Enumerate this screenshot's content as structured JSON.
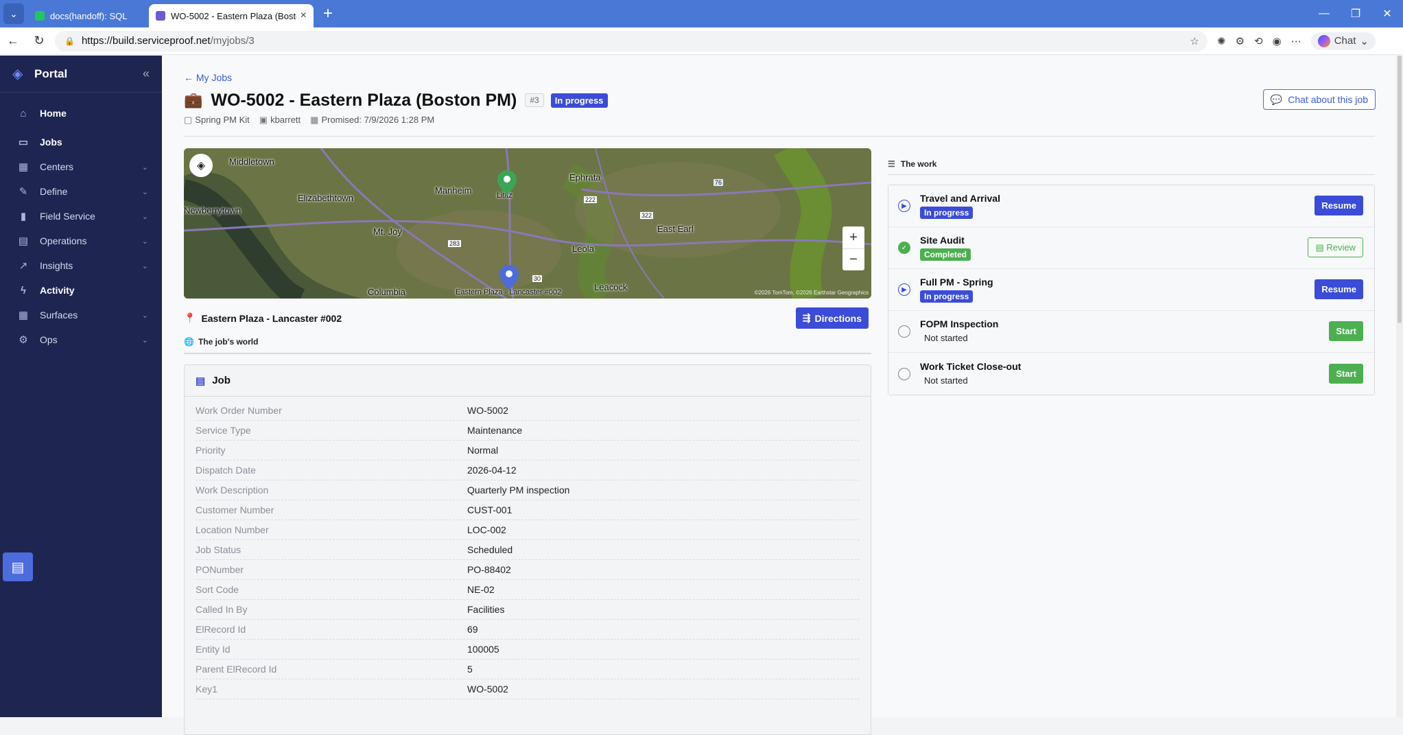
{
  "browser": {
    "tabs": [
      {
        "title": "docs(handoff): SQL",
        "active": false
      },
      {
        "title": "WO-5002 - Eastern Plaza (Boston PM)",
        "active": true
      }
    ],
    "url_host": "https://build.serviceproof.net",
    "url_path": "/myjobs/3",
    "chat_label": "Chat"
  },
  "sidebar": {
    "brand": "Portal",
    "items": [
      {
        "label": "Home",
        "icon": "home-icon",
        "chevron": false
      },
      {
        "label": "Jobs",
        "icon": "inbox-icon",
        "chevron": false
      },
      {
        "label": "Centers",
        "icon": "grid-icon",
        "chevron": true
      },
      {
        "label": "Define",
        "icon": "edit-icon",
        "chevron": true
      },
      {
        "label": "Field Service",
        "icon": "chart-bars-icon",
        "chevron": true
      },
      {
        "label": "Operations",
        "icon": "briefcase-icon",
        "chevron": true
      },
      {
        "label": "Insights",
        "icon": "trend-icon",
        "chevron": true
      },
      {
        "label": "Activity",
        "icon": "bolt-icon",
        "chevron": false
      },
      {
        "label": "Surfaces",
        "icon": "apps-icon",
        "chevron": true
      },
      {
        "label": "Ops",
        "icon": "gear-icon",
        "chevron": true
      }
    ]
  },
  "page": {
    "back_label": "My Jobs",
    "title": "WO-5002 - Eastern Plaza (Boston PM)",
    "number_badge": "#3",
    "status": "In progress",
    "chat_job_label": "Chat about this job",
    "meta": {
      "kit": "Spring PM Kit",
      "user": "kbarrett",
      "promised": "Promised: 7/9/2026 1:28 PM"
    }
  },
  "map": {
    "labels": [
      "Middletown",
      "Elizabethtown",
      "Newberrytown",
      "Manheim",
      "Lititz",
      "Ephrata",
      "Mt. Joy",
      "Leola",
      "East Earl",
      "Columbia",
      "Leacock",
      "Eastern Plaza - Lancaster #002"
    ],
    "route_shields": [
      "222",
      "322",
      "283",
      "30",
      "76"
    ],
    "copyright": "©2026 TomTom, ©2026 Earthstar Geographics",
    "zoom_in": "+",
    "zoom_out": "−"
  },
  "location": {
    "name": "Eastern Plaza - Lancaster #002",
    "directions_label": "Directions"
  },
  "world_title": "The job's world",
  "job": {
    "header": "Job",
    "fields": [
      {
        "k": "Work Order Number",
        "v": "WO-5002"
      },
      {
        "k": "Service Type",
        "v": "Maintenance"
      },
      {
        "k": "Priority",
        "v": "Normal"
      },
      {
        "k": "Dispatch Date",
        "v": "2026-04-12"
      },
      {
        "k": "Work Description",
        "v": "Quarterly PM inspection"
      },
      {
        "k": "Customer Number",
        "v": "CUST-001"
      },
      {
        "k": "Location Number",
        "v": "LOC-002"
      },
      {
        "k": "Job Status",
        "v": "Scheduled"
      },
      {
        "k": "PONumber",
        "v": "PO-88402"
      },
      {
        "k": "Sort Code",
        "v": "NE-02"
      },
      {
        "k": "Called In By",
        "v": "Facilities"
      },
      {
        "k": "ElRecord Id",
        "v": "69"
      },
      {
        "k": "Entity Id",
        "v": "100005"
      },
      {
        "k": "Parent ElRecord Id",
        "v": "5"
      },
      {
        "k": "Key1",
        "v": "WO-5002"
      }
    ]
  },
  "work": {
    "title": "The work",
    "tasks": [
      {
        "name": "Travel and Arrival",
        "status": "In progress",
        "action": "Resume"
      },
      {
        "name": "Site Audit",
        "status": "Completed",
        "action": "Review"
      },
      {
        "name": "Full PM - Spring",
        "status": "In progress",
        "action": "Resume"
      },
      {
        "name": "FOPM Inspection",
        "status": "Not started",
        "action": "Start"
      },
      {
        "name": "Work Ticket Close-out",
        "status": "Not started",
        "action": "Start"
      }
    ]
  }
}
